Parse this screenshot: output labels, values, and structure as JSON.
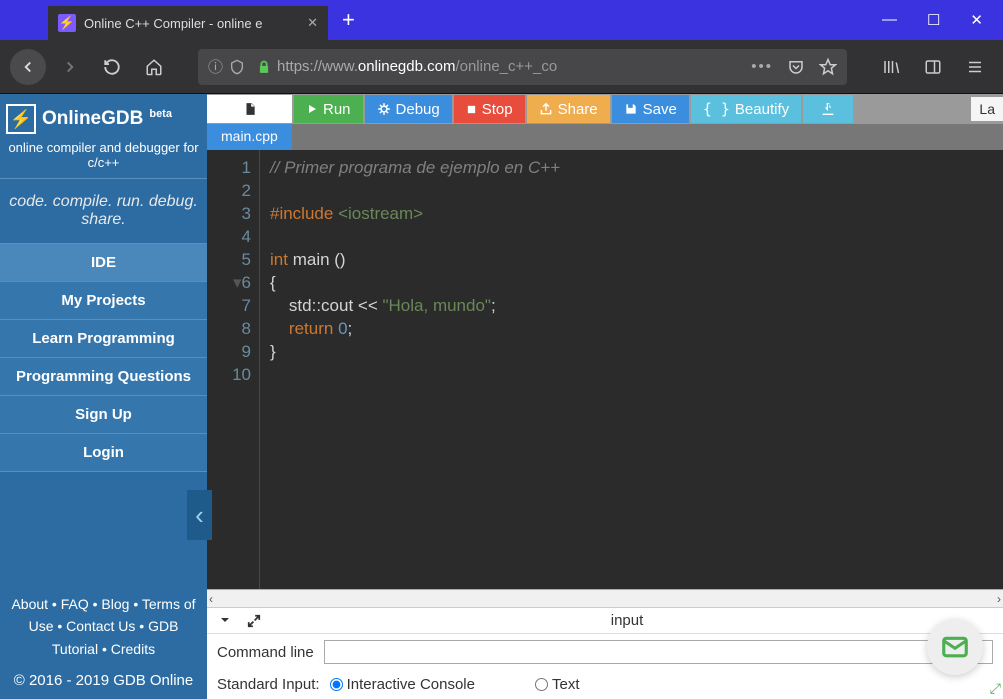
{
  "browser": {
    "tab_title": "Online C++ Compiler - online e",
    "url_prefix": "https://www.",
    "url_domain": "onlinegdb.com",
    "url_path": "/online_c++_co"
  },
  "sidebar": {
    "brand": "OnlineGDB",
    "beta": "beta",
    "subtitle": "online compiler and debugger for c/c++",
    "tagline": "code. compile. run. debug. share.",
    "items": [
      "IDE",
      "My Projects",
      "Learn Programming",
      "Programming Questions",
      "Sign Up",
      "Login"
    ],
    "footer_links": "About • FAQ • Blog • Terms of Use • Contact Us • GDB Tutorial • Credits",
    "copyright": "© 2016 - 2019 GDB Online"
  },
  "actions": {
    "run": "Run",
    "debug": "Debug",
    "stop": "Stop",
    "share": "Share",
    "save": "Save",
    "beautify": "Beautify",
    "lang_hint": "La"
  },
  "filetab": "main.cpp",
  "code": {
    "lines": [
      "1",
      "2",
      "3",
      "4",
      "5",
      "6",
      "7",
      "8",
      "9",
      "10"
    ],
    "l1": "// Primer programa de ejemplo en C++",
    "l3a": "#include",
    "l3b": "<iostream>",
    "l5a": "int",
    "l5b": "main ()",
    "l6": "{",
    "l7a": "std",
    "l7b": "::",
    "l7c": "cout",
    "l7d": " << ",
    "l7e": "\"Hola, mundo\"",
    "l7f": ";",
    "l8a": "return",
    "l8b": "0",
    "l8c": ";",
    "l9": "}"
  },
  "panel": {
    "title": "input",
    "cmd_label": "Command line",
    "stdin_label": "Standard Input:",
    "opt_interactive": "Interactive Console",
    "opt_text": "Text"
  }
}
